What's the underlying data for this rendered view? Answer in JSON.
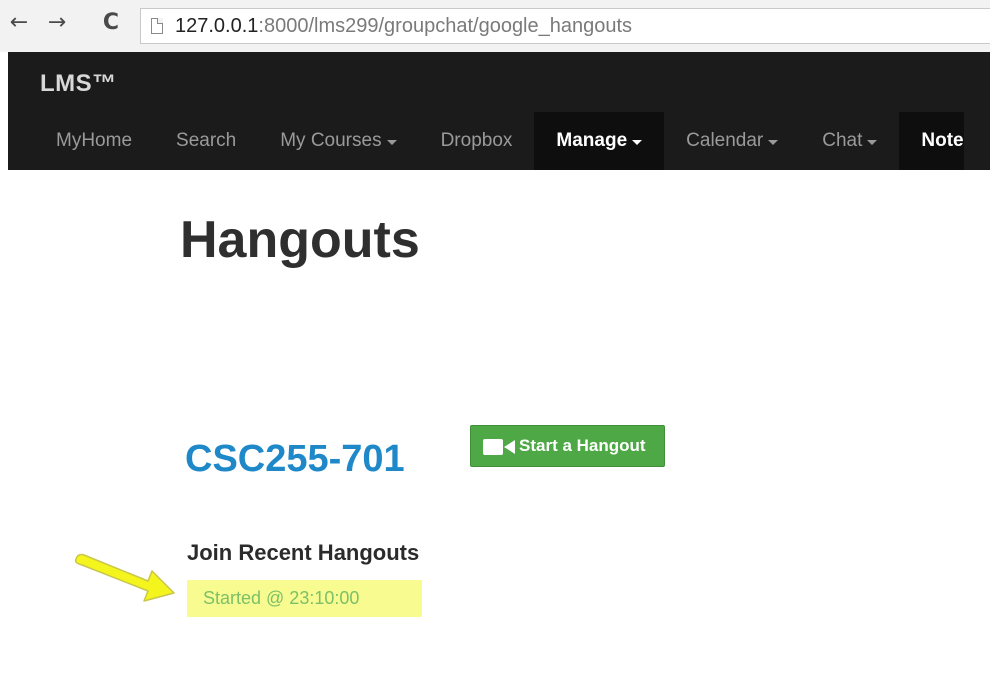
{
  "browser": {
    "back_glyph": "←",
    "forward_glyph": "→",
    "reload_glyph": "C",
    "url_host": "127.0.0.1",
    "url_rest": ":8000/lms299/groupchat/google_hangouts",
    "icons": [
      "back-arrow-icon",
      "forward-arrow-icon",
      "reload-icon",
      "page-icon"
    ]
  },
  "navbar": {
    "brand": "LMS™",
    "items": [
      {
        "label": "MyHome"
      },
      {
        "label": "Search"
      },
      {
        "label": "My Courses"
      },
      {
        "label": "Dropbox"
      },
      {
        "label": "Manage"
      },
      {
        "label": "Calendar"
      },
      {
        "label": "Chat"
      },
      {
        "label": "Note"
      }
    ],
    "active_item": "Manage"
  },
  "main": {
    "title": "Hangouts",
    "course": "CSC255-701",
    "start_button_label": "Start a Hangout",
    "start_button_icon": "video-camera-icon",
    "recent_heading": "Join Recent Hangouts",
    "recent_hangouts": [
      {
        "label": "Started @ 23:10:00"
      }
    ],
    "annotation_icon": "yellow-arrow-icon"
  },
  "colors": {
    "navbar_bg": "#1b1b1b",
    "course_blue": "#1e88c9",
    "button_green": "#4ea846",
    "highlight_yellow": "#f8fb90",
    "link_green": "#7cc067"
  }
}
